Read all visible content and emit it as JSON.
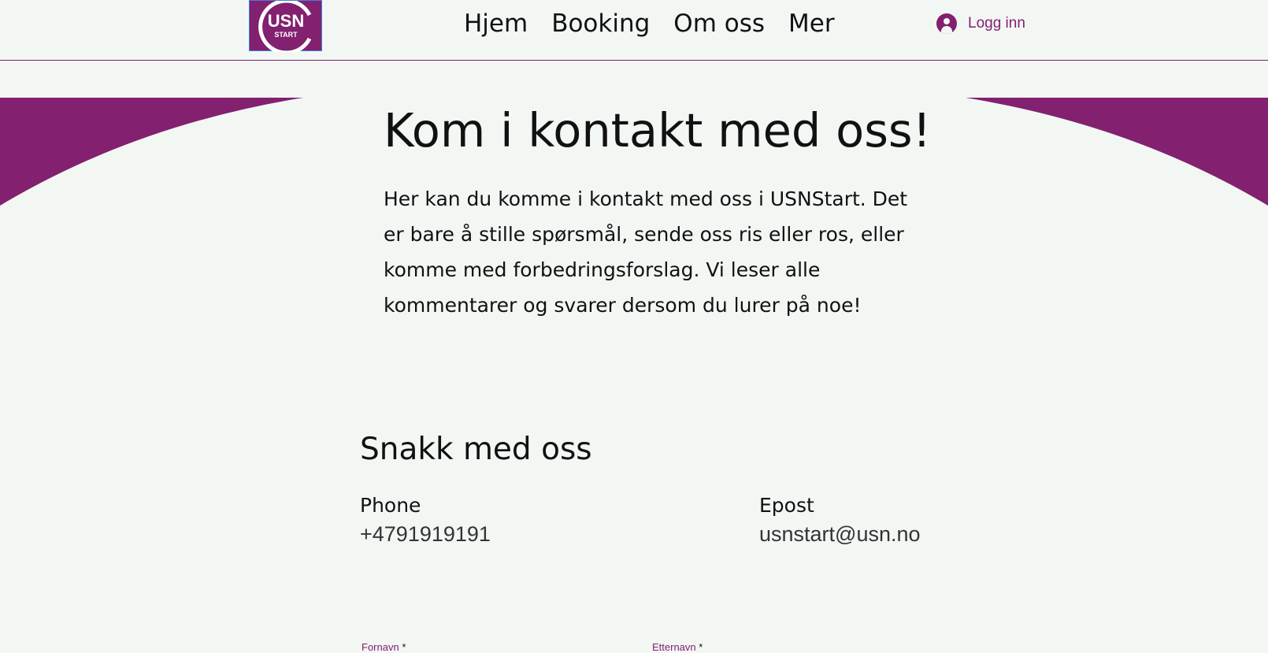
{
  "colors": {
    "brand": "#83206f",
    "background": "#f3f7f4",
    "text": "#111111"
  },
  "header": {
    "logo": {
      "line1": "USN",
      "line2": "START"
    },
    "nav": [
      {
        "label": "Hjem"
      },
      {
        "label": "Booking"
      },
      {
        "label": "Om oss"
      },
      {
        "label": "Mer"
      }
    ],
    "login": {
      "icon": "user-avatar-icon",
      "label": "Logg inn"
    }
  },
  "hero": {
    "title": "Kom i kontakt med oss!",
    "text": "Her kan du komme i kontakt med oss i USNStart. Det er bare å stille spørsmål, sende oss ris eller ros, eller komme med forbedringsforslag. Vi leser alle kommentarer og svarer dersom du lurer på noe!"
  },
  "contact": {
    "title": "Snakk med oss",
    "phone": {
      "label": "Phone",
      "value": "+4791919191"
    },
    "email": {
      "label": "Epost",
      "value": "usnstart@usn.no"
    }
  },
  "form": {
    "first_name_label": "Fornavn",
    "last_name_label": "Etternavn",
    "required_marker": "*"
  }
}
